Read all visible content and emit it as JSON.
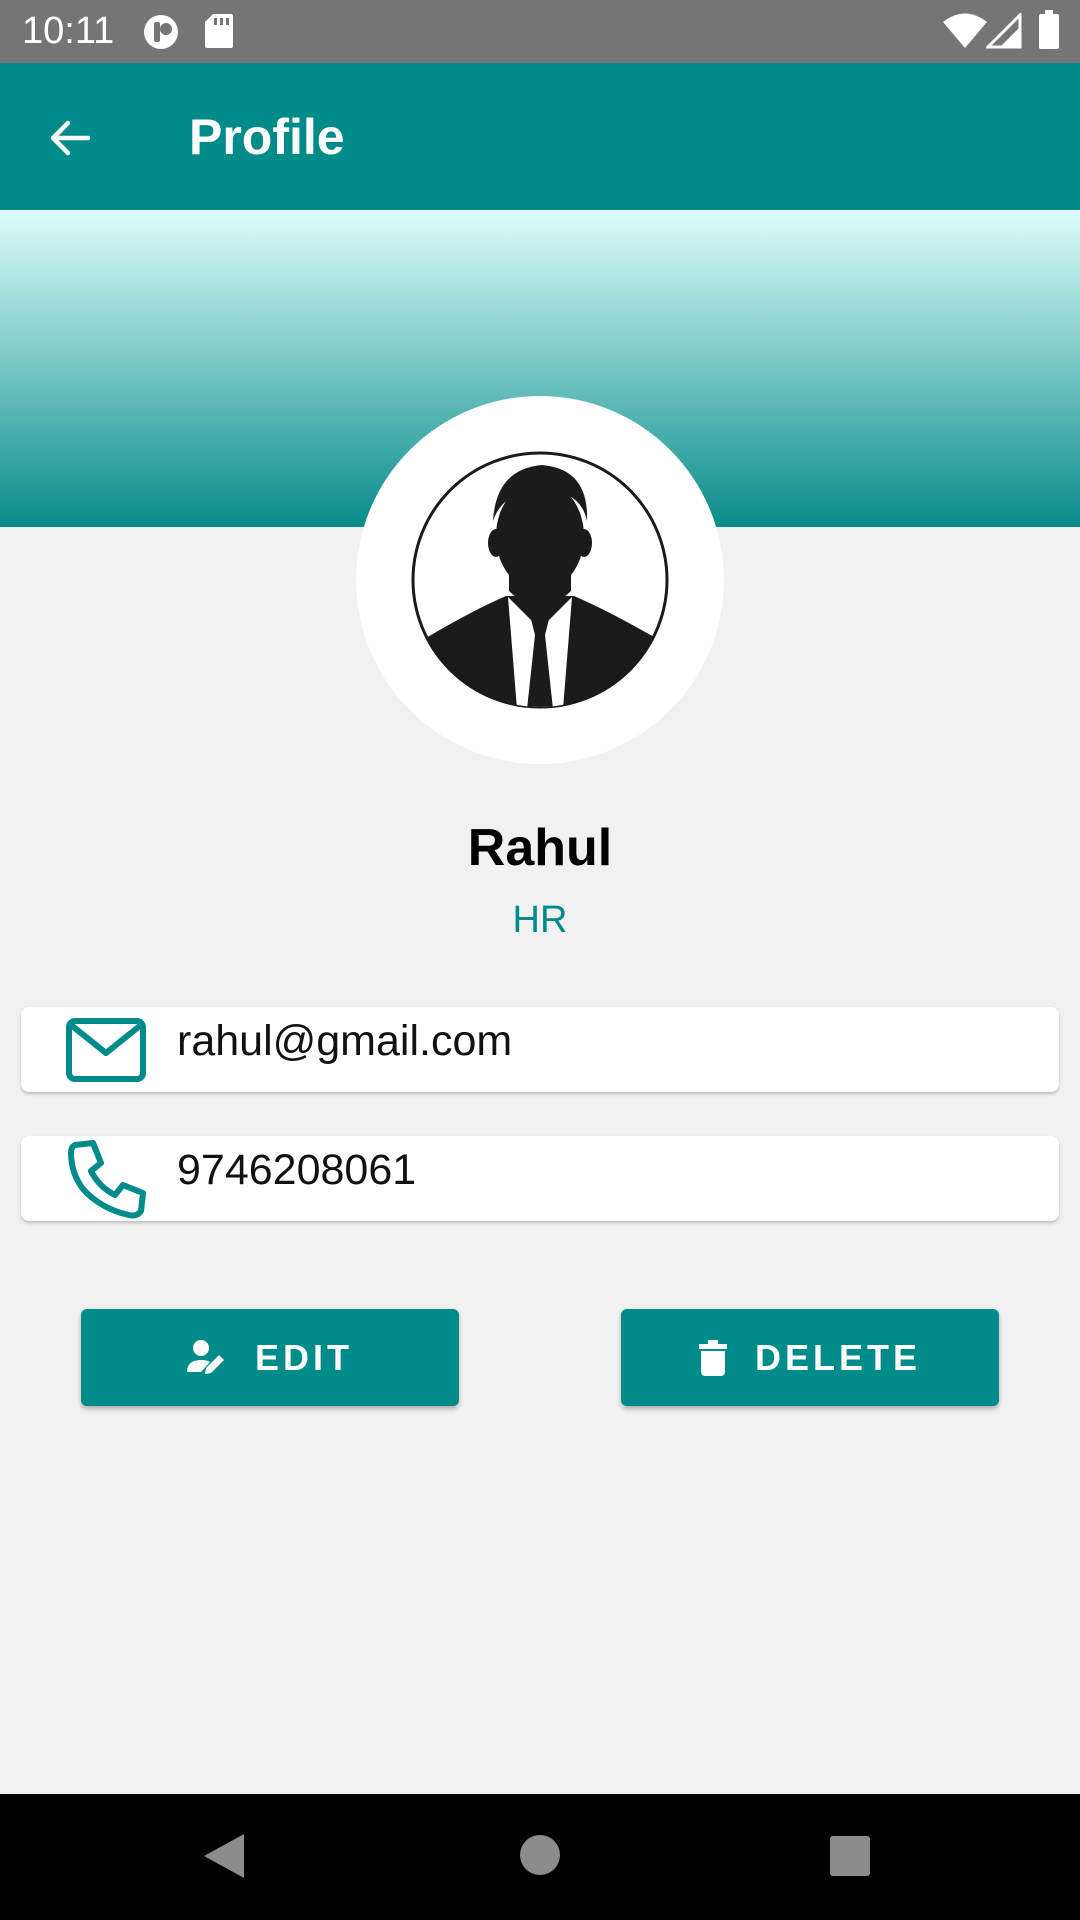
{
  "status_bar": {
    "time": "10:11",
    "icons": [
      "app-notification-icon",
      "sd-card-icon",
      "wifi-icon",
      "cell-signal-icon",
      "battery-icon"
    ]
  },
  "app_bar": {
    "title": "Profile",
    "back_icon": "arrow-back-icon"
  },
  "profile": {
    "name": "Rahul",
    "role": "HR",
    "avatar_icon": "user-silhouette-icon"
  },
  "contact": {
    "email": "rahul@gmail.com",
    "email_icon": "mail-icon",
    "phone": "9746208061",
    "phone_icon": "phone-icon"
  },
  "actions": {
    "edit_label": "EDIT",
    "edit_icon": "edit-person-icon",
    "delete_label": "DELETE",
    "delete_icon": "trash-icon"
  },
  "nav_bar": {
    "buttons": [
      "back-triangle-icon",
      "home-circle-icon",
      "recents-square-icon"
    ]
  },
  "colors": {
    "primary": "#008b8b",
    "status_bar": "#757575",
    "background": "#f1f1f1",
    "gradient_top": "#ddfdfb"
  }
}
